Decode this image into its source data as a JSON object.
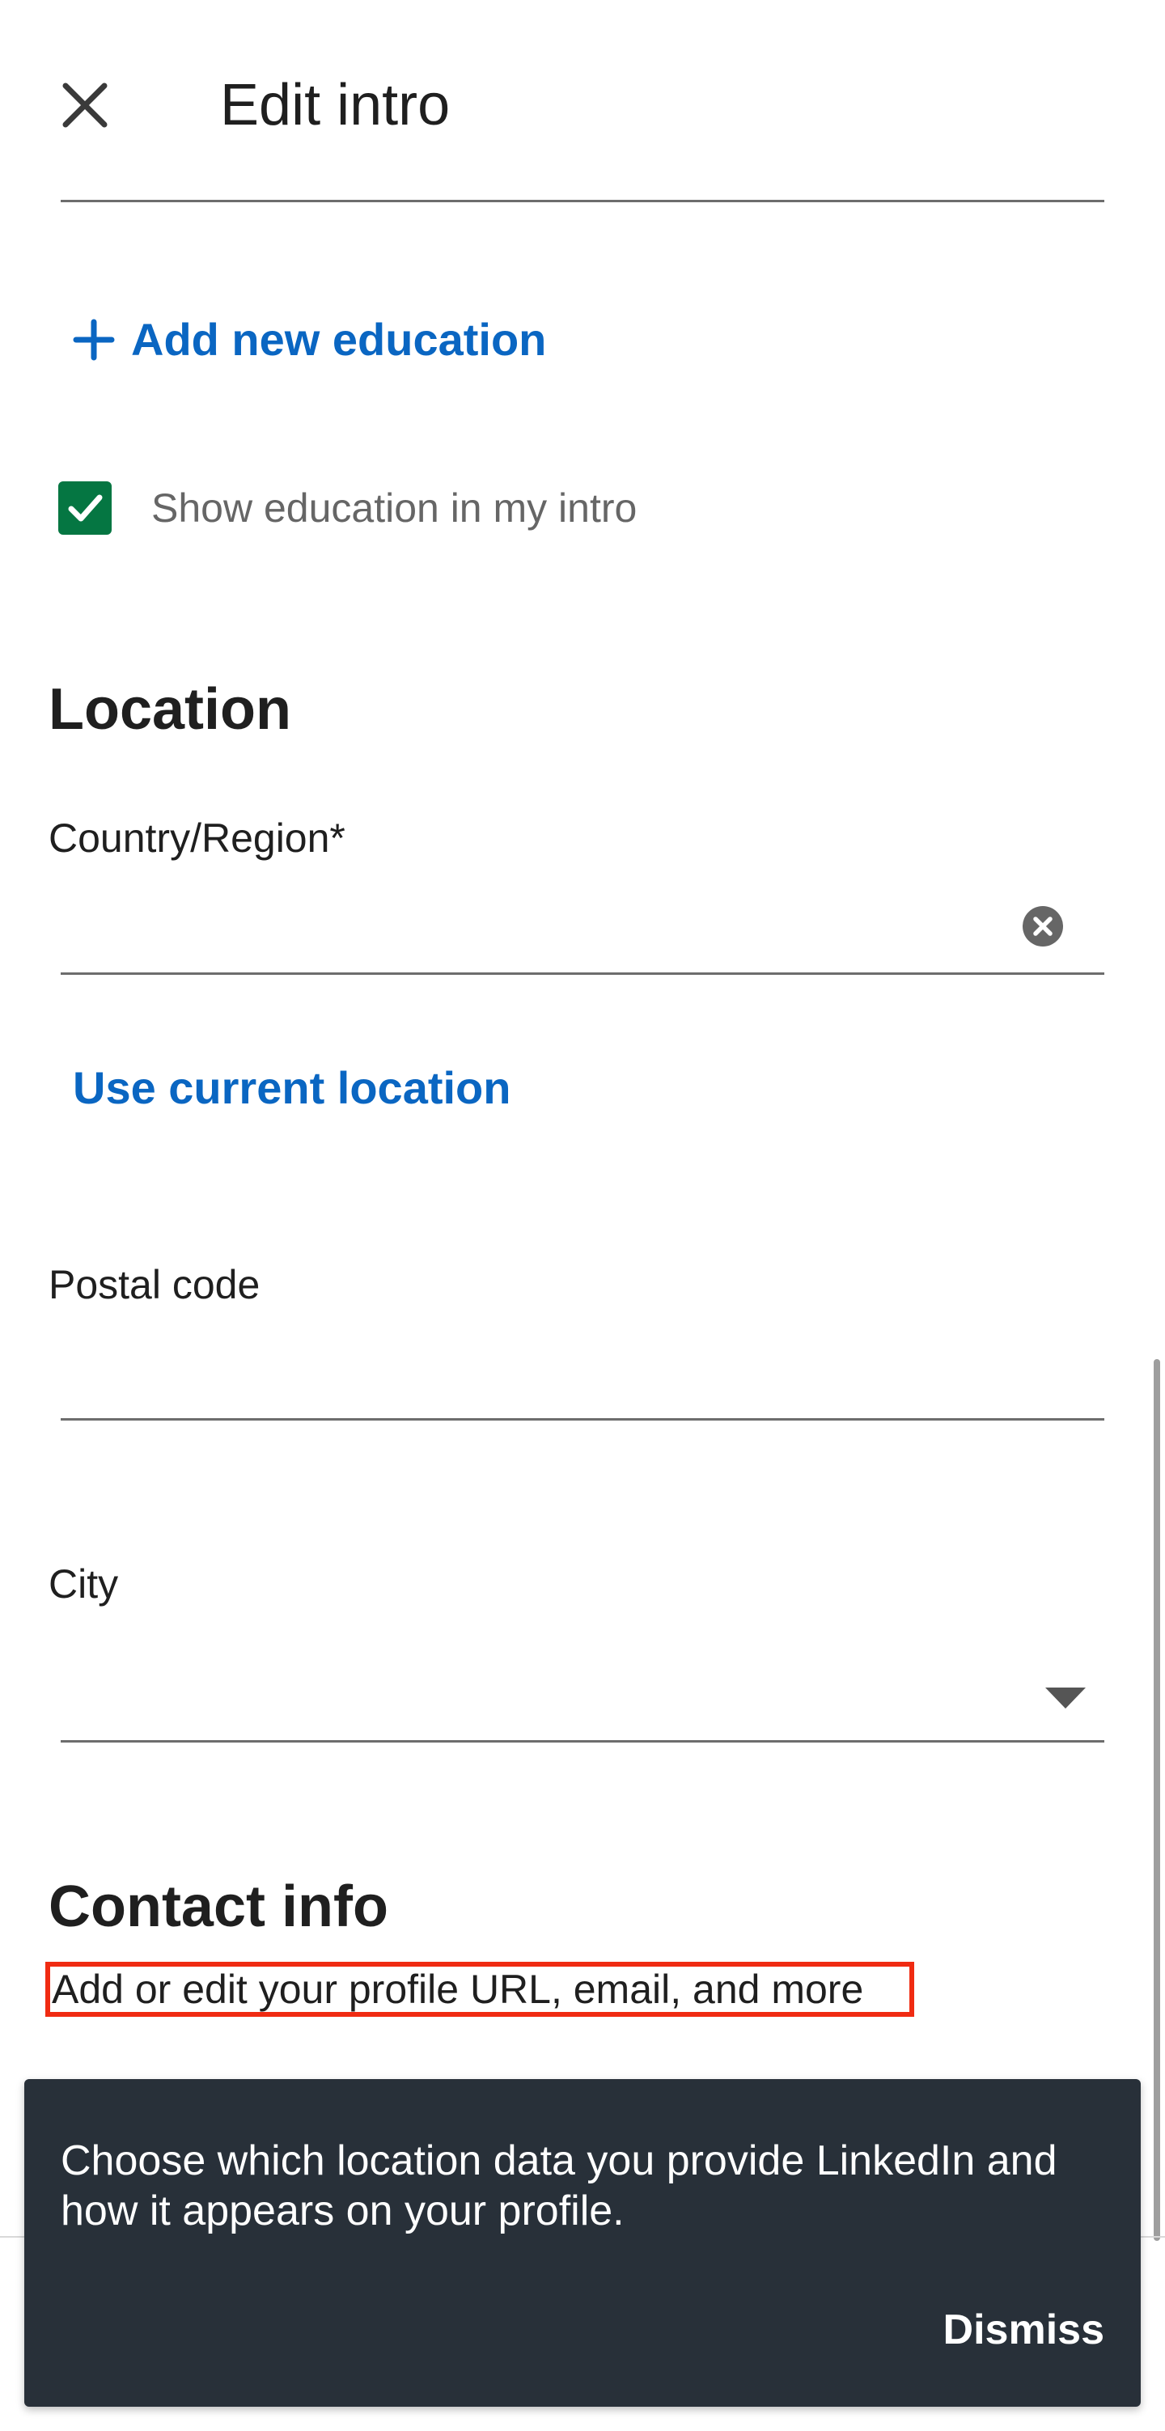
{
  "header": {
    "title": "Edit intro",
    "close_icon": "close-icon"
  },
  "education": {
    "add_label": "Add new education",
    "add_icon": "plus-icon",
    "show_checkbox_label": "Show education in my intro",
    "show_checkbox_checked": true
  },
  "location": {
    "heading": "Location",
    "country_label": "Country/Region*",
    "country_value": "",
    "use_current_location": "Use current location",
    "postal_label": "Postal code",
    "postal_value": "",
    "city_label": "City",
    "city_value": ""
  },
  "contact": {
    "heading": "Contact info",
    "subtitle": "Add or edit your profile URL, email, and more"
  },
  "snackbar": {
    "message": "Choose which location data you provide LinkedIn and how it appears on your profile.",
    "dismiss": "Dismiss"
  },
  "colors": {
    "accent_link": "#0a66c2",
    "checkbox_green": "#057642",
    "snackbar_bg": "#283039",
    "highlight_red": "#f02b12"
  }
}
